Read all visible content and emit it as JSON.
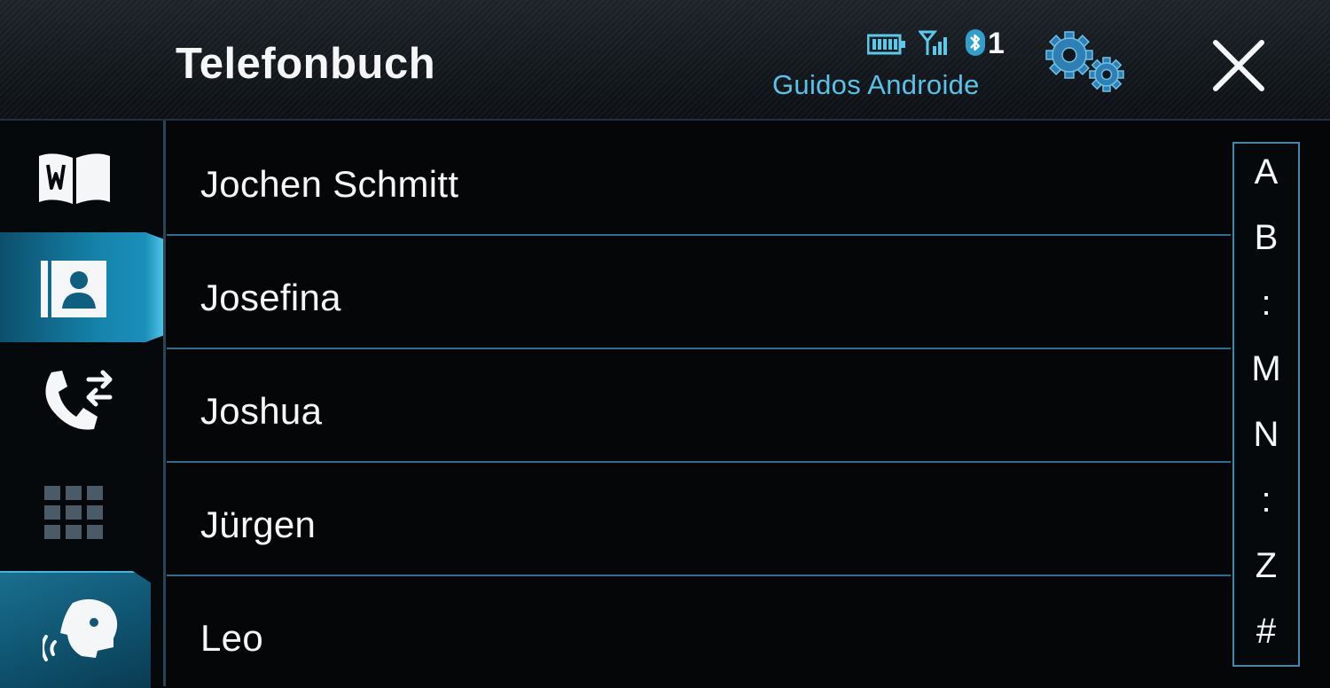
{
  "header": {
    "title": "Telefonbuch",
    "device_name": "Guidos Androide",
    "bluetooth_count": "1",
    "icons": [
      "battery-icon",
      "signal-icon",
      "bluetooth-icon",
      "settings-gears-icon",
      "close-icon"
    ]
  },
  "sidebar": {
    "items": [
      {
        "name": "phonebook-book-icon",
        "active": false
      },
      {
        "name": "contacts-icon",
        "active": true
      },
      {
        "name": "call-history-icon",
        "active": false
      },
      {
        "name": "keypad-icon",
        "active": false
      },
      {
        "name": "voice-assistant-icon",
        "active": false
      }
    ]
  },
  "contacts": [
    {
      "name": "Jochen Schmitt"
    },
    {
      "name": "Josefina"
    },
    {
      "name": "Joshua"
    },
    {
      "name": "Jürgen"
    },
    {
      "name": "Leo"
    }
  ],
  "alphabet_index": [
    "A",
    "B",
    ":",
    "M",
    "N",
    ":",
    "Z",
    "#"
  ],
  "colors": {
    "accent": "#1a8fba",
    "device_name": "#59c2e6",
    "divider": "#2f6d88",
    "gear": "#2f7fb5"
  }
}
